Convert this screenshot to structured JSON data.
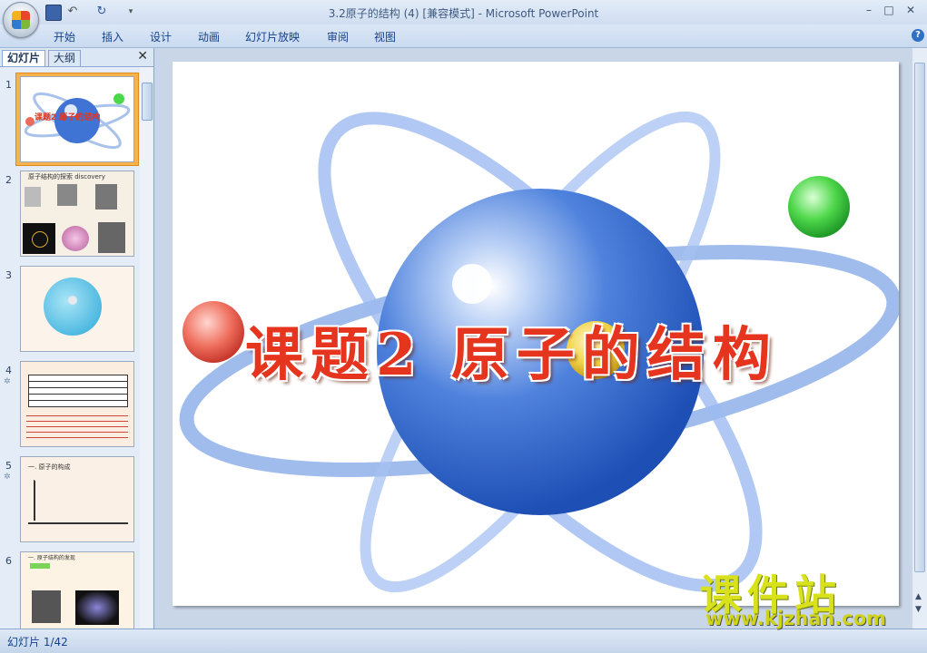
{
  "window": {
    "title": "3.2原子的结构 (4) [兼容模式] - Microsoft PowerPoint",
    "controls": [
      "–",
      "□",
      "✕"
    ]
  },
  "ribbon": {
    "tabs": [
      "开始",
      "插入",
      "设计",
      "动画",
      "幻灯片放映",
      "审阅",
      "视图"
    ],
    "help": "?"
  },
  "pane": {
    "tabs": [
      "幻灯片",
      "大纲"
    ],
    "close": "✕",
    "slides": [
      {
        "num": "1",
        "caption": "课题2 原子的结构"
      },
      {
        "num": "2",
        "caption": "原子结构的探索   discovery"
      },
      {
        "num": "3",
        "caption": ""
      },
      {
        "num": "4",
        "caption": ""
      },
      {
        "num": "5",
        "caption": "一. 原子的构成"
      },
      {
        "num": "6",
        "caption": "一. 原子结构的发现"
      }
    ]
  },
  "slide": {
    "title": "课题2 原子的结构"
  },
  "status": {
    "text": "幻灯片 1/42"
  },
  "watermark": {
    "main": "课件站",
    "sub": "www.kjzhan.com"
  },
  "colors": {
    "accent": "#15428b",
    "title_red": "#e5351f",
    "planet_blue": "#3c6fd1",
    "selection_orange": "#f6b24d"
  }
}
